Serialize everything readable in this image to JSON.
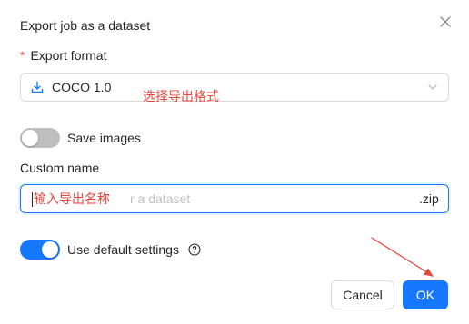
{
  "dialog": {
    "title": "Export job as a dataset",
    "export_format": {
      "required_mark": "*",
      "label": "Export format",
      "selected_value": "COCO 1.0",
      "annotation": "选择导出格式"
    },
    "save_images": {
      "label": "Save images",
      "enabled": false
    },
    "custom_name": {
      "label": "Custom name",
      "placeholder": "r a dataset",
      "suffix": ".zip",
      "annotation": "输入导出名称"
    },
    "use_default_settings": {
      "label": "Use default settings",
      "enabled": true
    },
    "buttons": {
      "cancel": "Cancel",
      "ok": "OK"
    }
  },
  "colors": {
    "primary": "#1677ff",
    "annotation": "#e8463c",
    "required": "#ff4d4f",
    "switch_off": "#bfbfbf"
  },
  "icons": {
    "close": "close-icon",
    "download": "download-icon",
    "chevron": "chevron-down-icon",
    "help": "question-circle-icon"
  }
}
